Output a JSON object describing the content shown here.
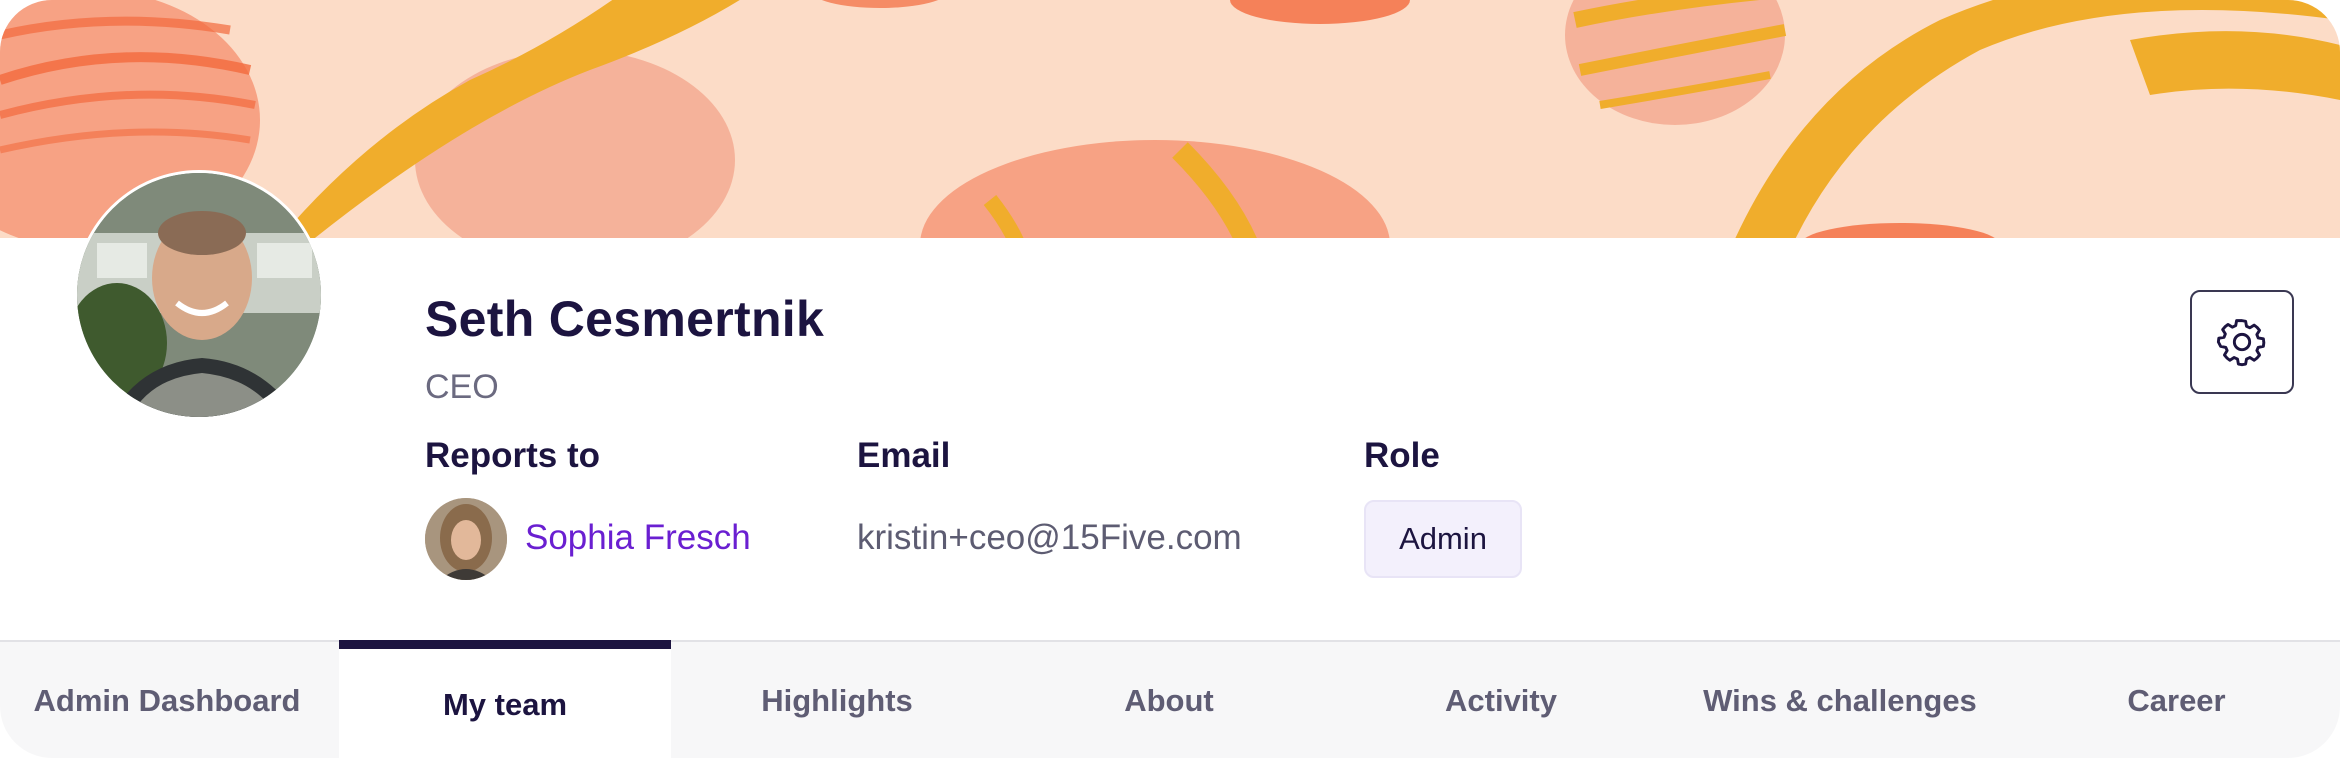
{
  "profile": {
    "name": "Seth Cesmertnik",
    "title": "CEO"
  },
  "details": {
    "reports_to_label": "Reports to",
    "manager_name": "Sophia Fresch",
    "email_label": "Email",
    "email_value": "kristin+ceo@15Five.com",
    "role_label": "Role",
    "role_value": "Admin"
  },
  "icons": {
    "settings": "gear-icon"
  },
  "tabs": [
    {
      "label": "Admin Dashboard",
      "active": false
    },
    {
      "label": "My team",
      "active": true
    },
    {
      "label": "Highlights",
      "active": false
    },
    {
      "label": "About",
      "active": false
    },
    {
      "label": "Activity",
      "active": false
    },
    {
      "label": "Wins & challenges",
      "active": false
    },
    {
      "label": "Career",
      "active": false
    }
  ],
  "colors": {
    "banner_bg": "#fcdcc7",
    "banner_orange": "#f26a3d",
    "banner_yellow": "#f0ad2c",
    "banner_pink": "#f6b39a",
    "accent_purple": "#6a1fd1",
    "dark_navy": "#1c1440"
  }
}
